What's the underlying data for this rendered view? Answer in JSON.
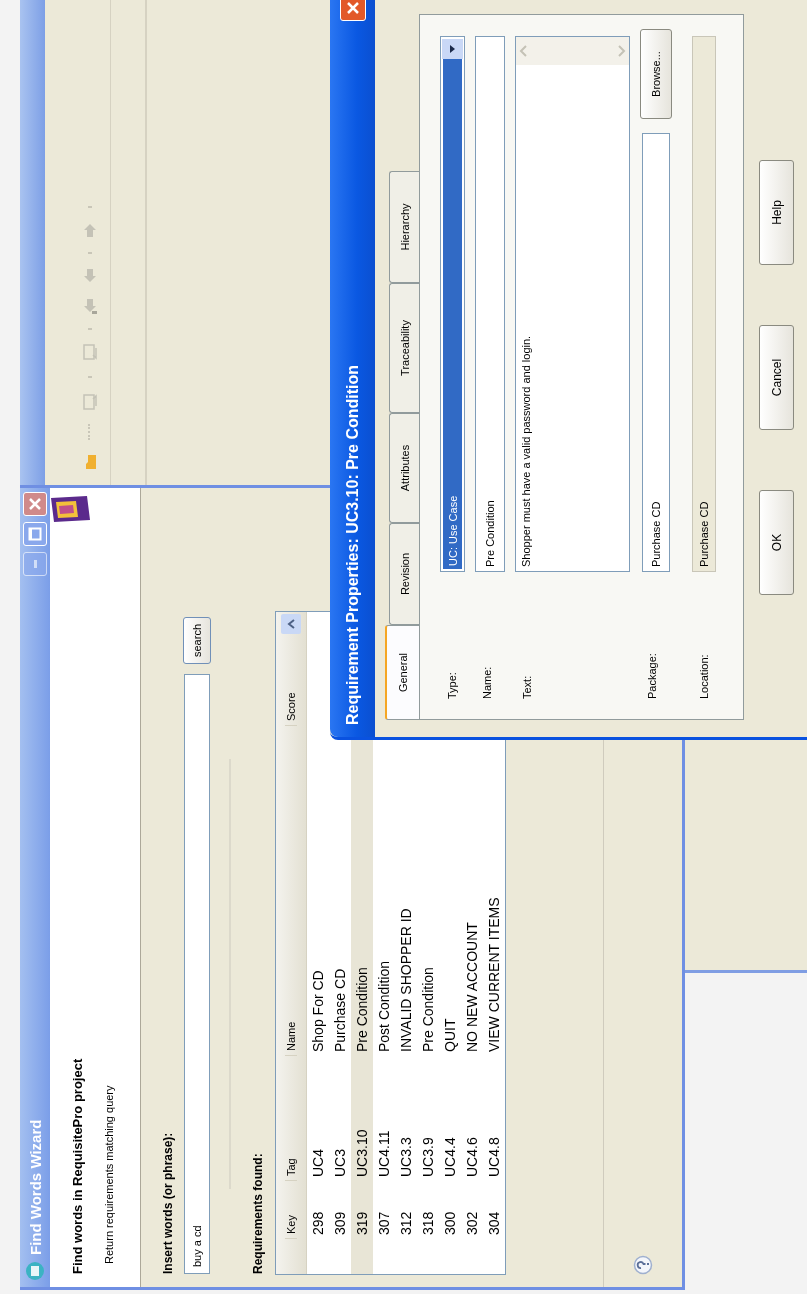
{
  "wizard": {
    "title": "Find Words Wizard",
    "heading": "Find words in RequisitePro project",
    "subheading": "Return requirements matching query",
    "query_label": "Insert words (or phrase):",
    "query": {
      "value": "buy a cd"
    },
    "search_button": "search",
    "results_label": "Requirements found:",
    "table": {
      "columns": [
        "Key",
        "Tag",
        "Name",
        "Score"
      ],
      "rows": [
        {
          "key": "298",
          "tag": "UC4",
          "name": "Shop For CD",
          "selected": false
        },
        {
          "key": "309",
          "tag": "UC3",
          "name": "Purchase CD",
          "selected": false
        },
        {
          "key": "319",
          "tag": "UC3.10",
          "name": "Pre Condition",
          "selected": true
        },
        {
          "key": "307",
          "tag": "UC4.11",
          "name": "Post Condition",
          "selected": false
        },
        {
          "key": "312",
          "tag": "UC3.3",
          "name": "INVALID SHOPPER ID",
          "selected": false
        },
        {
          "key": "318",
          "tag": "UC3.9",
          "name": "Pre Condition",
          "selected": false
        },
        {
          "key": "300",
          "tag": "UC4.4",
          "name": "QUIT",
          "selected": false
        },
        {
          "key": "302",
          "tag": "UC4.6",
          "name": "NO NEW ACCOUNT",
          "selected": false
        },
        {
          "key": "304",
          "tag": "UC4.8",
          "name": "VIEW CURRENT ITEMS",
          "selected": false
        }
      ]
    }
  },
  "dialog": {
    "title": "Requirement Properties: UC3.10: Pre Condition",
    "tabs": [
      {
        "label": "General",
        "selected": true
      },
      {
        "label": "Revision",
        "selected": false
      },
      {
        "label": "Attributes",
        "selected": false
      },
      {
        "label": "Traceability",
        "selected": false
      },
      {
        "label": "Hierarchy",
        "selected": false
      }
    ],
    "fields": [
      {
        "kind": "combo",
        "label": "Type:",
        "value": "UC: Use Case"
      },
      {
        "kind": "text",
        "label": "Name:",
        "value": "Pre Condition"
      },
      {
        "kind": "textarea",
        "label": "Text:",
        "value": "Shopper must have a valid password and login."
      },
      {
        "kind": "browse",
        "label": "Package:",
        "value": "Purchase CD",
        "button": "Browse..."
      },
      {
        "kind": "readonly",
        "label": "Location:",
        "value": "Purchase CD"
      }
    ],
    "buttons": [
      "OK",
      "Cancel",
      "Help"
    ]
  }
}
